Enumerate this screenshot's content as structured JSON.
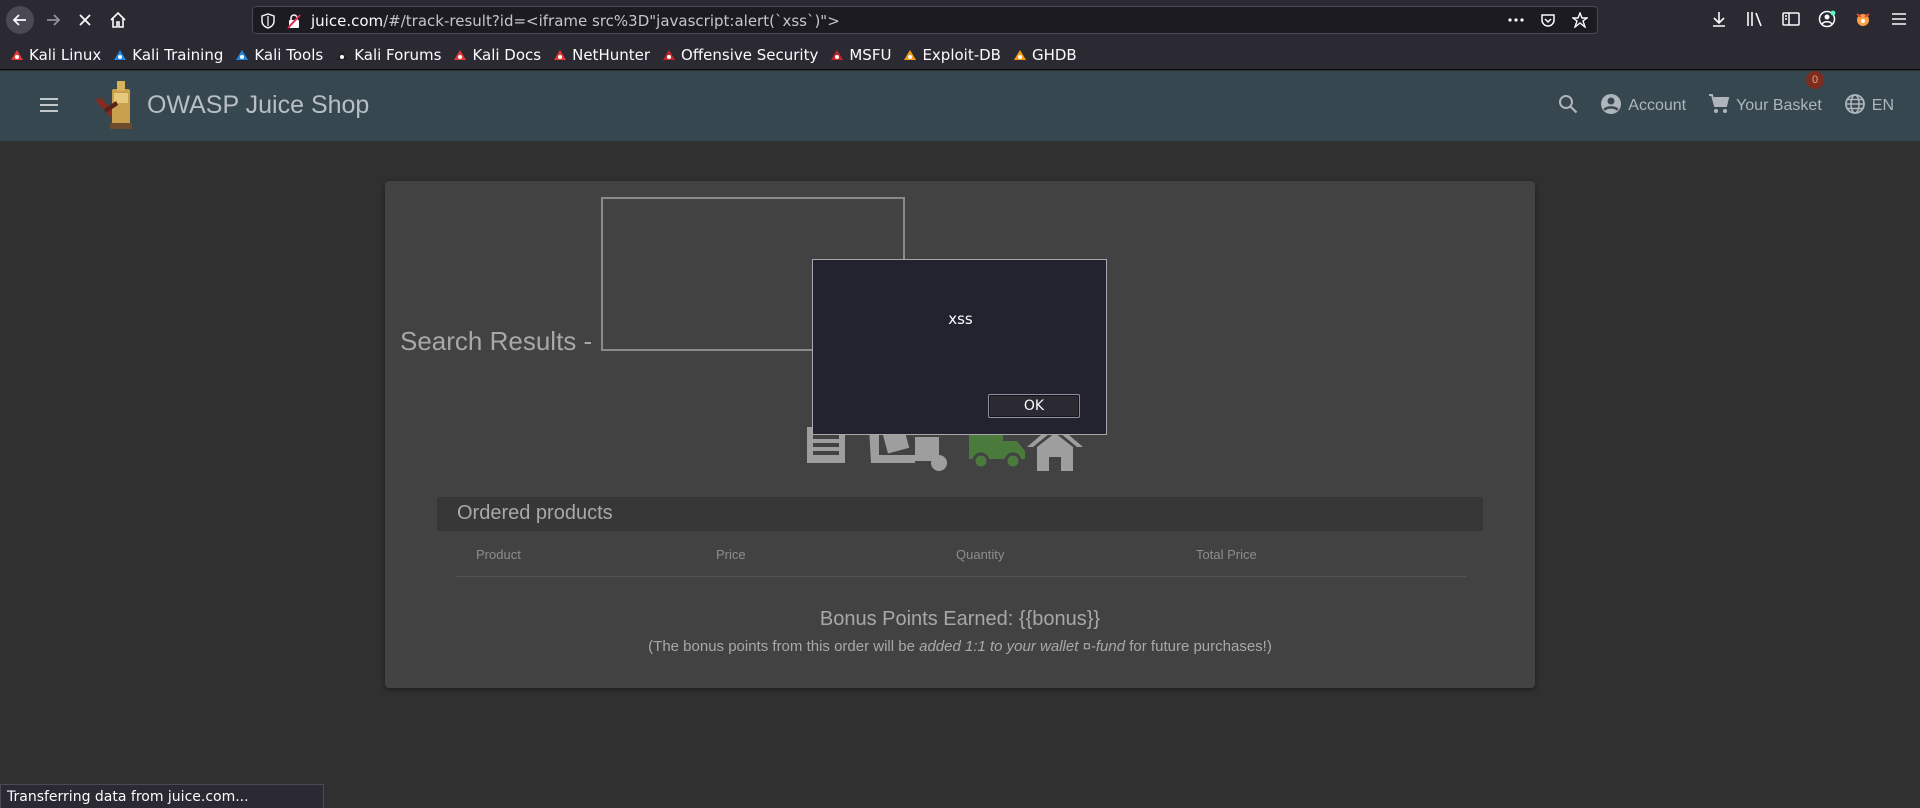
{
  "browser": {
    "url_host": "juice.com",
    "url_path": "/#/track-result?id=<iframe src%3D\"javascript:alert(`xss`)\">",
    "bookmarks": [
      {
        "label": "Kali Linux",
        "icon": "kali-icon",
        "color": "#e53935"
      },
      {
        "label": "Kali Training",
        "icon": "kali-training-icon",
        "color": "#1e88e5"
      },
      {
        "label": "Kali Tools",
        "icon": "kali-tools-icon",
        "color": "#1e88e5"
      },
      {
        "label": "Kali Forums",
        "icon": "kali-forums-icon",
        "color": "#222222"
      },
      {
        "label": "Kali Docs",
        "icon": "kali-docs-icon",
        "color": "#e53935"
      },
      {
        "label": "NetHunter",
        "icon": "nethunter-icon",
        "color": "#e53935"
      },
      {
        "label": "Offensive Security",
        "icon": "offsec-icon",
        "color": "#c62828"
      },
      {
        "label": "MSFU",
        "icon": "msfu-icon",
        "color": "#c62828"
      },
      {
        "label": "Exploit-DB",
        "icon": "exploitdb-icon",
        "color": "#f39c12"
      },
      {
        "label": "GHDB",
        "icon": "ghdb-icon",
        "color": "#f39c12"
      }
    ],
    "status_text": "Transferring data from juice.com..."
  },
  "app": {
    "title": "OWASP Juice Shop",
    "account_label": "Account",
    "basket_label": "Your Basket",
    "basket_count": "0",
    "language_label": "EN"
  },
  "track_result": {
    "search_results_label": "Search Results -",
    "ordered_products_label": "Ordered products",
    "columns": [
      "Product",
      "Price",
      "Quantity",
      "Total Price"
    ],
    "bonus_heading": "Bonus Points Earned: {{bonus}}",
    "bonus_note_before": "(The bonus points from this order will be ",
    "bonus_note_em": "added 1:1 to your wallet ¤-fund",
    "bonus_note_after": " for future purchases!)"
  },
  "alert": {
    "message": "xss",
    "ok_label": "OK"
  },
  "colors": {
    "toolbar": "#37474f",
    "page_bg": "#303030",
    "card_bg": "#424242",
    "truck_green": "#4a7a3c"
  }
}
